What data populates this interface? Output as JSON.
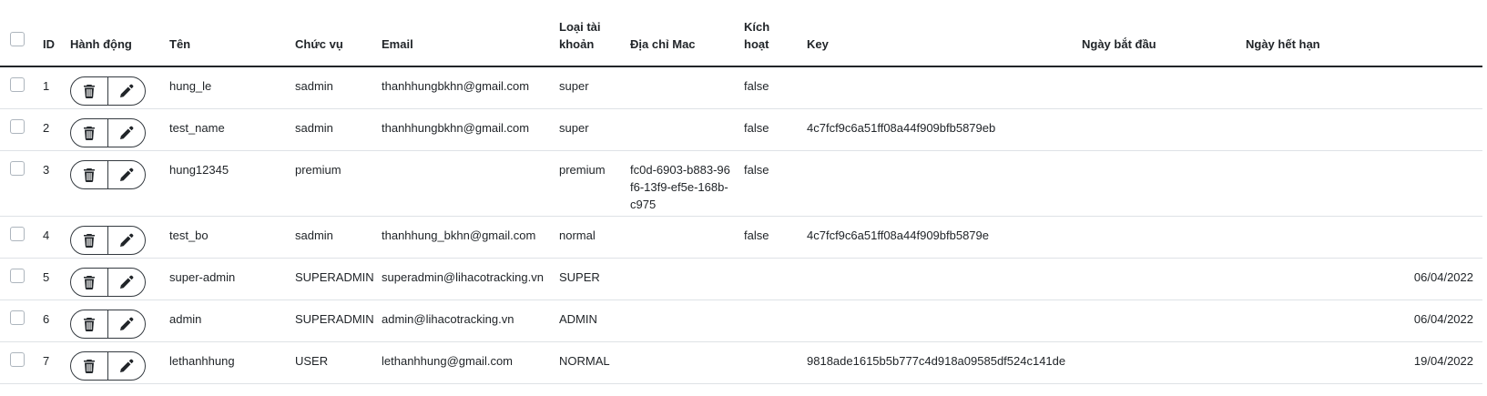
{
  "headers": {
    "id": "ID",
    "actions": "Hành động",
    "name": "Tên",
    "role": "Chức vụ",
    "email": "Email",
    "account_type": "Loại tài khoản",
    "mac": "Địa chỉ Mac",
    "active": "Kích hoạt",
    "key": "Key",
    "start_date": "Ngày bắt đầu",
    "end_date": "Ngày hết hạn"
  },
  "rows": [
    {
      "id": "1",
      "name": "hung_le",
      "role": "sadmin",
      "email": "thanhhungbkhn@gmail.com",
      "account_type": "super",
      "mac": "",
      "active": "false",
      "key": "",
      "start_date": "",
      "end_date": ""
    },
    {
      "id": "2",
      "name": "test_name",
      "role": "sadmin",
      "email": "thanhhungbkhn@gmail.com",
      "account_type": "super",
      "mac": "",
      "active": "false",
      "key": "4c7fcf9c6a51ff08a44f909bfb5879eb",
      "start_date": "",
      "end_date": ""
    },
    {
      "id": "3",
      "name": "hung12345",
      "role": "premium",
      "email": "",
      "account_type": "premium",
      "mac": "fc0d-6903-b883-96f6-13f9-ef5e-168b-c975",
      "active": "false",
      "key": "",
      "start_date": "",
      "end_date": ""
    },
    {
      "id": "4",
      "name": "test_bo",
      "role": "sadmin",
      "email": "thanhhung_bkhn@gmail.com",
      "account_type": "normal",
      "mac": "",
      "active": "false",
      "key": "4c7fcf9c6a51ff08a44f909bfb5879e",
      "start_date": "",
      "end_date": ""
    },
    {
      "id": "5",
      "name": "super-admin",
      "role": "SUPERADMIN",
      "email": "superadmin@lihacotracking.vn",
      "account_type": "SUPER",
      "mac": "",
      "active": "",
      "key": "",
      "start_date": "",
      "end_date": "06/04/2022"
    },
    {
      "id": "6",
      "name": "admin",
      "role": "SUPERADMIN",
      "email": "admin@lihacotracking.vn",
      "account_type": "ADMIN",
      "mac": "",
      "active": "",
      "key": "",
      "start_date": "",
      "end_date": "06/04/2022"
    },
    {
      "id": "7",
      "name": "lethanhhung",
      "role": "USER",
      "email": "lethanhhung@gmail.com",
      "account_type": "NORMAL",
      "mac": "",
      "active": "",
      "key": "9818ade1615b5b777c4d918a09585df524c141de",
      "start_date": "",
      "end_date": "19/04/2022"
    }
  ]
}
